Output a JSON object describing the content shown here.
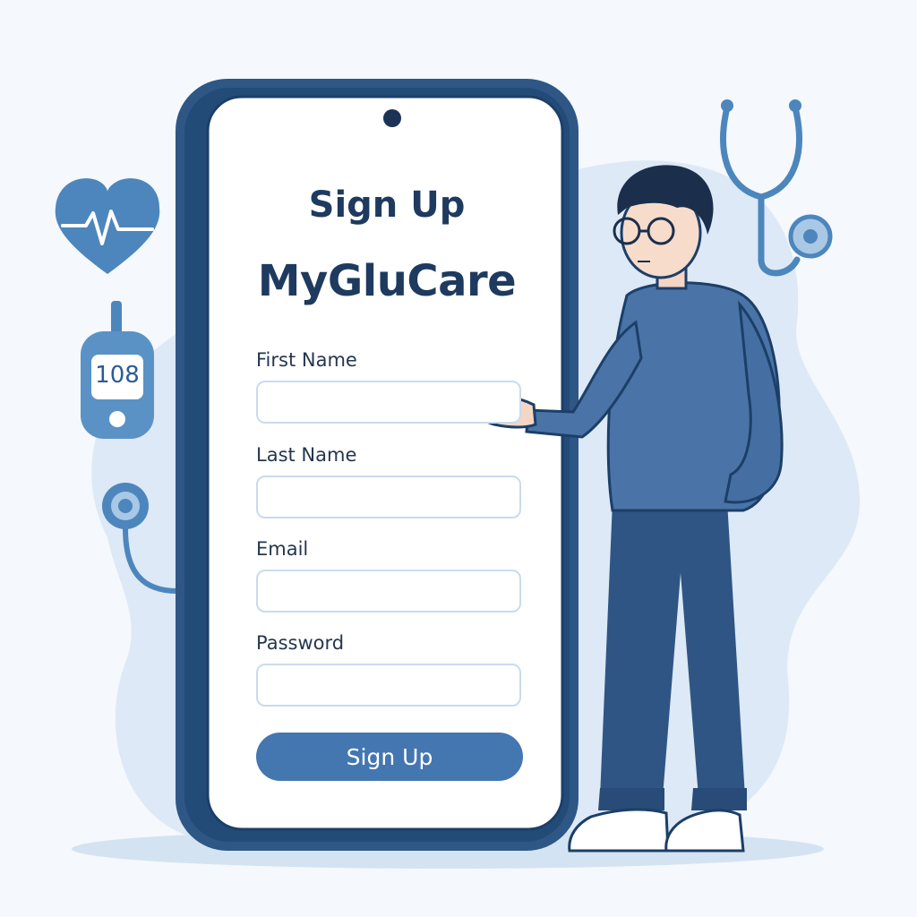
{
  "signup_form": {
    "heading": "Sign Up",
    "app_name": "MyGluCare",
    "fields": [
      {
        "label": "First Name",
        "value": "",
        "placeholder": ""
      },
      {
        "label": "Last Name",
        "value": "",
        "placeholder": ""
      },
      {
        "label": "Email",
        "value": "",
        "placeholder": ""
      },
      {
        "label": "Password",
        "value": "",
        "placeholder": ""
      }
    ],
    "submit_label": "Sign Up"
  },
  "decorations": {
    "glucose_reading": "108",
    "icons": [
      "heart-pulse-icon",
      "glucose-meter-icon",
      "stethoscope-icon"
    ]
  },
  "colors": {
    "primary": "#4476b0",
    "heading": "#1e3a5f",
    "phone_frame": "#2e5786",
    "background_blob": "#dbe8f5",
    "input_border": "#c9dbee"
  }
}
